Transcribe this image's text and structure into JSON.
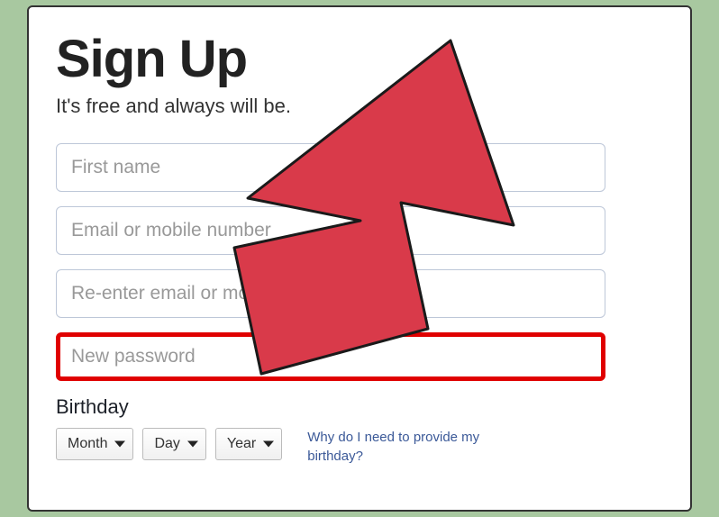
{
  "heading": {
    "title": "Sign Up",
    "subtitle": "It's free and always will be."
  },
  "fields": {
    "first_name": {
      "placeholder": "First name"
    },
    "email": {
      "placeholder": "Email or mobile number"
    },
    "reemail": {
      "placeholder": "Re-enter email or mobile number"
    },
    "password": {
      "placeholder": "New password"
    }
  },
  "birthday": {
    "label": "Birthday",
    "month": "Month",
    "day": "Day",
    "year": "Year",
    "help_link": "Why do I need to provide my birthday?"
  }
}
